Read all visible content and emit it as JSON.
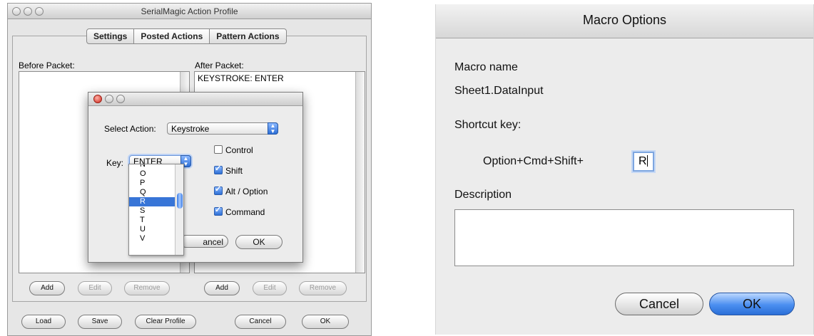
{
  "left_window": {
    "title": "SerialMagic Action Profile",
    "tabs": [
      "Settings",
      "Posted Actions",
      "Pattern Actions"
    ],
    "selected_tab": "Posted Actions",
    "before_label": "Before Packet:",
    "after_label": "After Packet:",
    "after_items": [
      "KEYSTROKE: ENTER"
    ],
    "before_buttons": {
      "add": "Add",
      "edit": "Edit",
      "remove": "Remove"
    },
    "after_buttons": {
      "add": "Add",
      "edit": "Edit",
      "remove": "Remove"
    },
    "bottom_buttons": {
      "load": "Load",
      "save": "Save",
      "clear": "Clear Profile",
      "cancel": "Cancel",
      "ok": "OK"
    }
  },
  "modal": {
    "select_action_label": "Select Action:",
    "select_action_value": "Keystroke",
    "key_label": "Key:",
    "key_value": "ENTER",
    "checkboxes": [
      {
        "label": "Control",
        "checked": false
      },
      {
        "label": "Shift",
        "checked": true
      },
      {
        "label": "Alt / Option",
        "checked": true
      },
      {
        "label": "Command",
        "checked": true
      }
    ],
    "cancel_partial": "ancel",
    "ok": "OK",
    "key_options": [
      "N",
      "O",
      "P",
      "Q",
      "R",
      "S",
      "T",
      "U",
      "V"
    ],
    "selected_key": "R"
  },
  "right_window": {
    "title": "Macro Options",
    "macro_name_label": "Macro name",
    "macro_name_value": "Sheet1.DataInput",
    "shortcut_label": "Shortcut key:",
    "shortcut_prefix": "Option+Cmd+Shift+",
    "shortcut_value": "R",
    "description_label": "Description",
    "description_value": "",
    "cancel": "Cancel",
    "ok": "OK"
  },
  "colors": {
    "selection": "#3875d7",
    "default_button": "#4a8ef0",
    "close_button": "#d0281c"
  }
}
